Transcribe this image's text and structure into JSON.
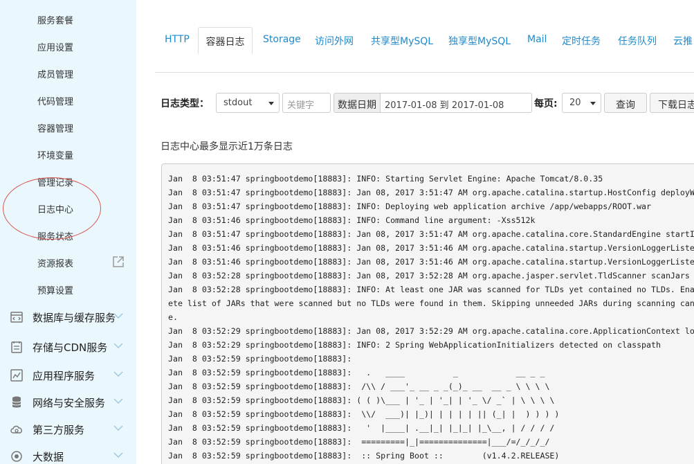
{
  "sidebar": {
    "sub_items": [
      {
        "label": "服务套餐"
      },
      {
        "label": "应用设置"
      },
      {
        "label": "成员管理"
      },
      {
        "label": "代码管理"
      },
      {
        "label": "容器管理"
      },
      {
        "label": "环境变量"
      },
      {
        "label": "管理记录"
      },
      {
        "label": "日志中心"
      },
      {
        "label": "服务状态"
      },
      {
        "label": "资源报表"
      },
      {
        "label": "预算设置"
      }
    ],
    "groups": [
      {
        "label": "数据库与缓存服务",
        "icon": "database-cache-icon"
      },
      {
        "label": "存储与CDN服务",
        "icon": "storage-icon"
      },
      {
        "label": "应用程序服务",
        "icon": "chart-icon"
      },
      {
        "label": "网络与安全服务",
        "icon": "network-icon"
      },
      {
        "label": "第三方服务",
        "icon": "cloud-icon"
      },
      {
        "label": "大数据",
        "icon": "bigdata-icon"
      }
    ]
  },
  "tabs": [
    {
      "label": "HTTP"
    },
    {
      "label": "容器日志"
    },
    {
      "label": "Storage"
    },
    {
      "label": "访问外网"
    },
    {
      "label": "共享型MySQL"
    },
    {
      "label": "独享型MySQL"
    },
    {
      "label": "Mail"
    },
    {
      "label": "定时任务"
    },
    {
      "label": "任务队列"
    },
    {
      "label": "云推"
    }
  ],
  "filter": {
    "log_type_label": "日志类型：",
    "log_type_value": "stdout",
    "keyword_placeholder": "关键字",
    "date_label": "数据日期",
    "date_range": "2017-01-08 到  2017-01-08",
    "per_page_label": "每页:",
    "per_page_value": "20",
    "query_button": "查询",
    "download_button": "下载日志"
  },
  "note": "日志中心最多显示近1万条日志",
  "log_lines": [
    "Jan  8 03:51:47 springbootdemo[18883]: INFO: Starting Servlet Engine: Apache Tomcat/8.0.35",
    "Jan  8 03:51:47 springbootdemo[18883]: Jan 08, 2017 3:51:47 AM org.apache.catalina.startup.HostConfig deployWAR",
    "Jan  8 03:51:47 springbootdemo[18883]: INFO: Deploying web application archive /app/webapps/ROOT.war",
    "Jan  8 03:51:46 springbootdemo[18883]: INFO: Command line argument: -Xss512k",
    "Jan  8 03:51:47 springbootdemo[18883]: Jan 08, 2017 3:51:47 AM org.apache.catalina.core.StandardEngine startInternal",
    "Jan  8 03:51:46 springbootdemo[18883]: Jan 08, 2017 3:51:46 AM org.apache.catalina.startup.VersionLoggerListener",
    "Jan  8 03:51:46 springbootdemo[18883]: Jan 08, 2017 3:51:46 AM org.apache.catalina.startup.VersionLoggerListener",
    "Jan  8 03:52:28 springbootdemo[18883]: Jan 08, 2017 3:52:28 AM org.apache.jasper.servlet.TldScanner scanJars",
    "Jan  8 03:52:28 springbootdemo[18883]: INFO: At least one JAR was scanned for TLDs yet contained no TLDs. Enable",
    "ete list of JARs that were scanned but no TLDs were found in them. Skipping unneeded JARs during scanning can",
    "e.",
    "Jan  8 03:52:29 springbootdemo[18883]: Jan 08, 2017 3:52:29 AM org.apache.catalina.core.ApplicationContext log",
    "Jan  8 03:52:29 springbootdemo[18883]: INFO: 2 Spring WebApplicationInitializers detected on classpath",
    "Jan  8 03:52:59 springbootdemo[18883]:",
    "Jan  8 03:52:59 springbootdemo[18883]:   .   ____          _            __ _ _",
    "Jan  8 03:52:59 springbootdemo[18883]:  /\\\\ / ___'_ __ _ _(_)_ __  __ _ \\ \\ \\ \\",
    "Jan  8 03:52:59 springbootdemo[18883]: ( ( )\\___ | '_ | '_| | '_ \\/ _` | \\ \\ \\ \\",
    "Jan  8 03:52:59 springbootdemo[18883]:  \\\\/  ___)| |_)| | | | | || (_| |  ) ) ) )",
    "Jan  8 03:52:59 springbootdemo[18883]:   '  |____| .__|_| |_|_| |_\\__, | / / / /",
    "Jan  8 03:52:59 springbootdemo[18883]:  =========|_|==============|___/=/_/_/_/",
    "Jan  8 03:52:59 springbootdemo[18883]:  :: Spring Boot ::        (v1.4.2.RELEASE)"
  ]
}
